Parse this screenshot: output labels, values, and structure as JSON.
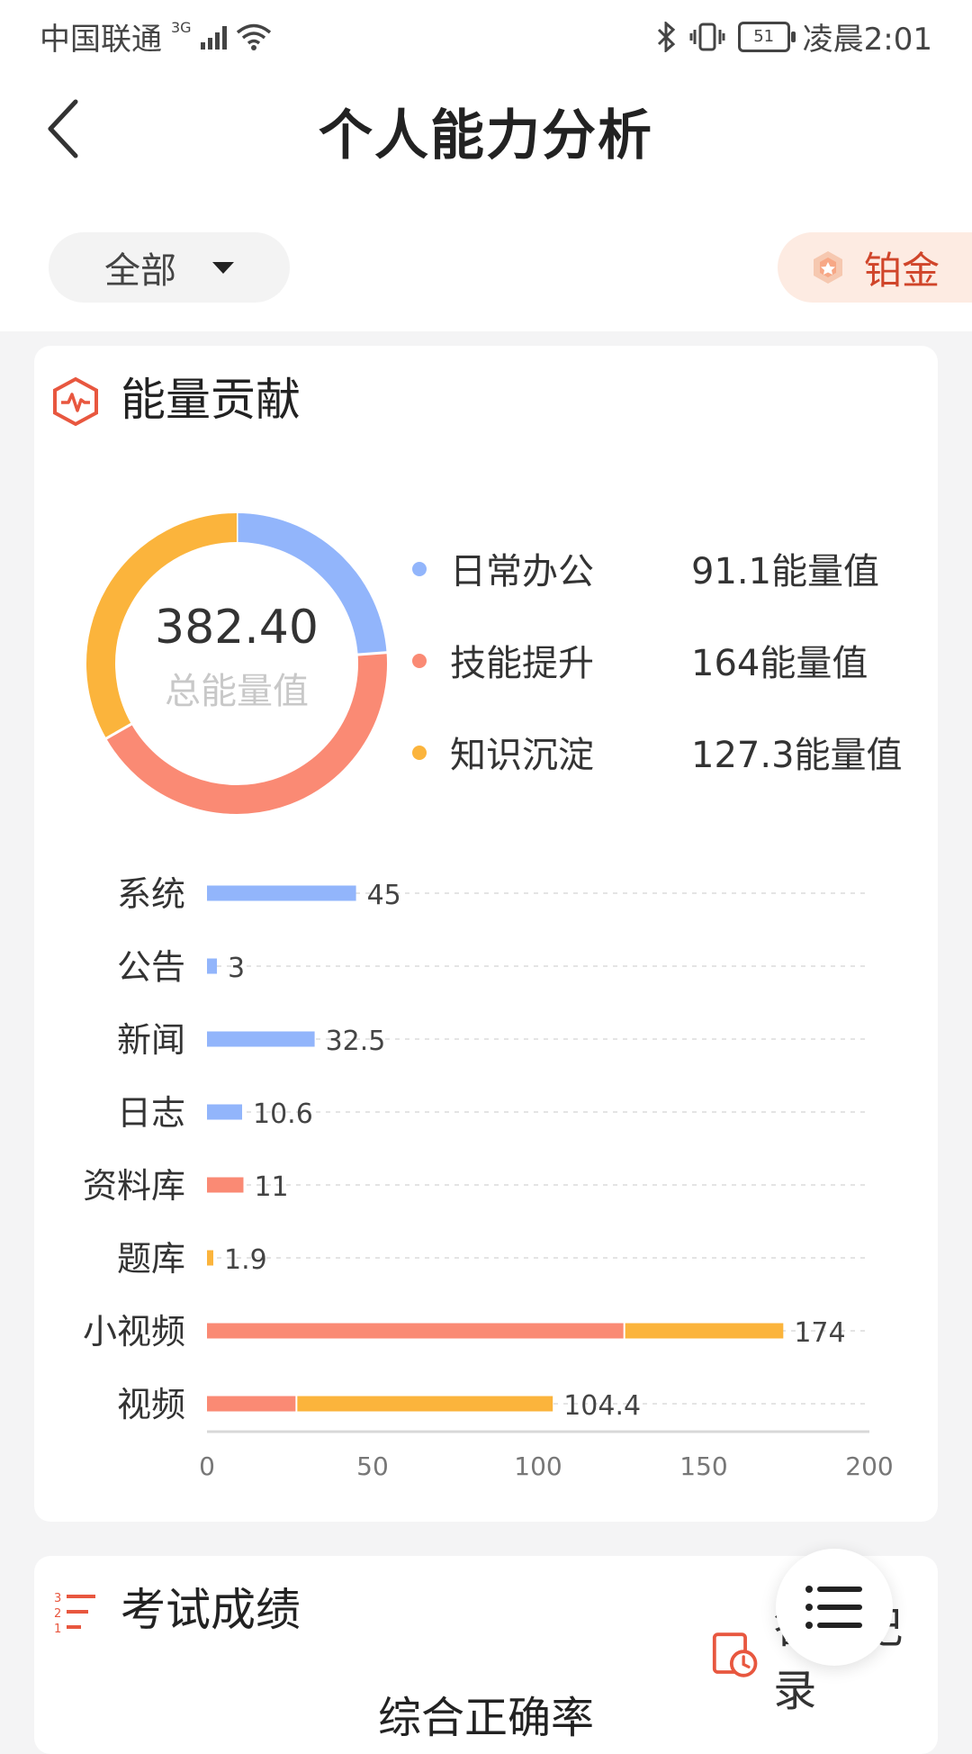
{
  "status_bar": {
    "carrier": "中国联通",
    "network": "3G",
    "battery": "51",
    "time": "凌晨2:01"
  },
  "header": {
    "title": "个人能力分析",
    "filter_label": "全部",
    "level_badge": "铂金"
  },
  "energy_card": {
    "title": "能量贡献",
    "total_value": "382.40",
    "total_label": "总能量值",
    "legend": [
      {
        "name": "日常办公",
        "value": "91.1能量值",
        "color": "#92b5fb"
      },
      {
        "name": "技能提升",
        "value": "164能量值",
        "color": "#fa8a74"
      },
      {
        "name": "知识沉淀",
        "value": "127.3能量值",
        "color": "#fbb43c"
      }
    ]
  },
  "chart_data": [
    {
      "type": "pie",
      "title": "",
      "center_text": "382.40",
      "center_subtext": "总能量值",
      "categories": [
        "日常办公",
        "技能提升",
        "知识沉淀"
      ],
      "values": [
        91.1,
        164,
        127.3
      ],
      "colors": [
        "#92b5fb",
        "#fa8a74",
        "#fbb43c"
      ]
    },
    {
      "type": "bar",
      "orientation": "horizontal",
      "stacked": true,
      "categories": [
        "系统",
        "公告",
        "新闻",
        "日志",
        "资料库",
        "题库",
        "小视频",
        "视频"
      ],
      "series": [
        {
          "values": [
            45,
            3,
            32.5,
            10.6,
            0,
            0,
            0,
            0
          ],
          "color": "#92b5fb"
        },
        {
          "values": [
            0,
            0,
            0,
            0,
            11,
            0,
            126,
            27
          ],
          "color": "#fa8a74"
        },
        {
          "values": [
            0,
            0,
            0,
            0,
            0,
            1.9,
            48,
            77.4
          ],
          "color": "#fbb43c"
        }
      ],
      "totals": [
        "45",
        "3",
        "32.5",
        "10.6",
        "11",
        "1.9",
        "174",
        "104.4"
      ],
      "xlim": [
        0,
        200
      ],
      "xticks": [
        "0",
        "50",
        "100",
        "150",
        "200"
      ],
      "grid": true
    }
  ],
  "exam_card": {
    "title": "考试成绩",
    "answer_record": "答题记录",
    "subtitle": "综合正确率"
  }
}
